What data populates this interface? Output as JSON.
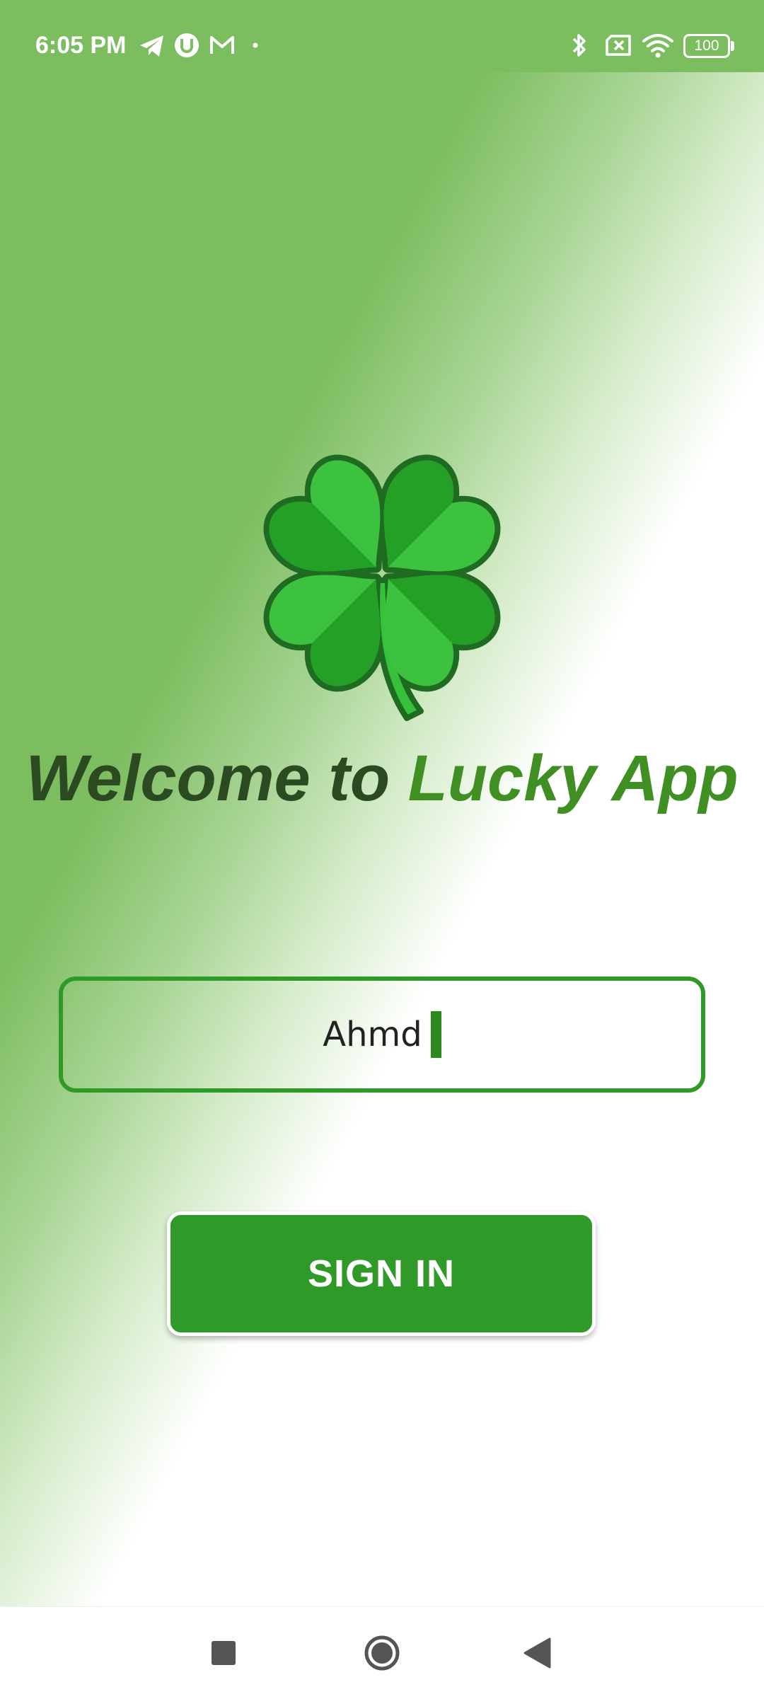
{
  "status_bar": {
    "time": "6:05 PM",
    "left_icons": [
      "telegram-icon",
      "notification-u-icon",
      "gmail-icon",
      "dot-icon"
    ],
    "right_icons": [
      "bluetooth-icon",
      "sim-disabled-icon",
      "wifi-icon",
      "battery-icon"
    ],
    "battery_level": "100"
  },
  "welcome": {
    "logo": "four-leaf-clover-icon",
    "title_part1": "Welcome to",
    "title_part2": "Lucky App"
  },
  "login": {
    "name_value": "Ahmd",
    "signin_label": "SIGN IN"
  },
  "nav_bar": {
    "buttons": [
      "recents-square-icon",
      "home-circle-icon",
      "back-triangle-icon"
    ]
  },
  "colors": {
    "accent_green": "#2f9a28",
    "background_green": "#7cbd5f",
    "title_dark": "#2b4a22",
    "title_green": "#3f8f22"
  }
}
